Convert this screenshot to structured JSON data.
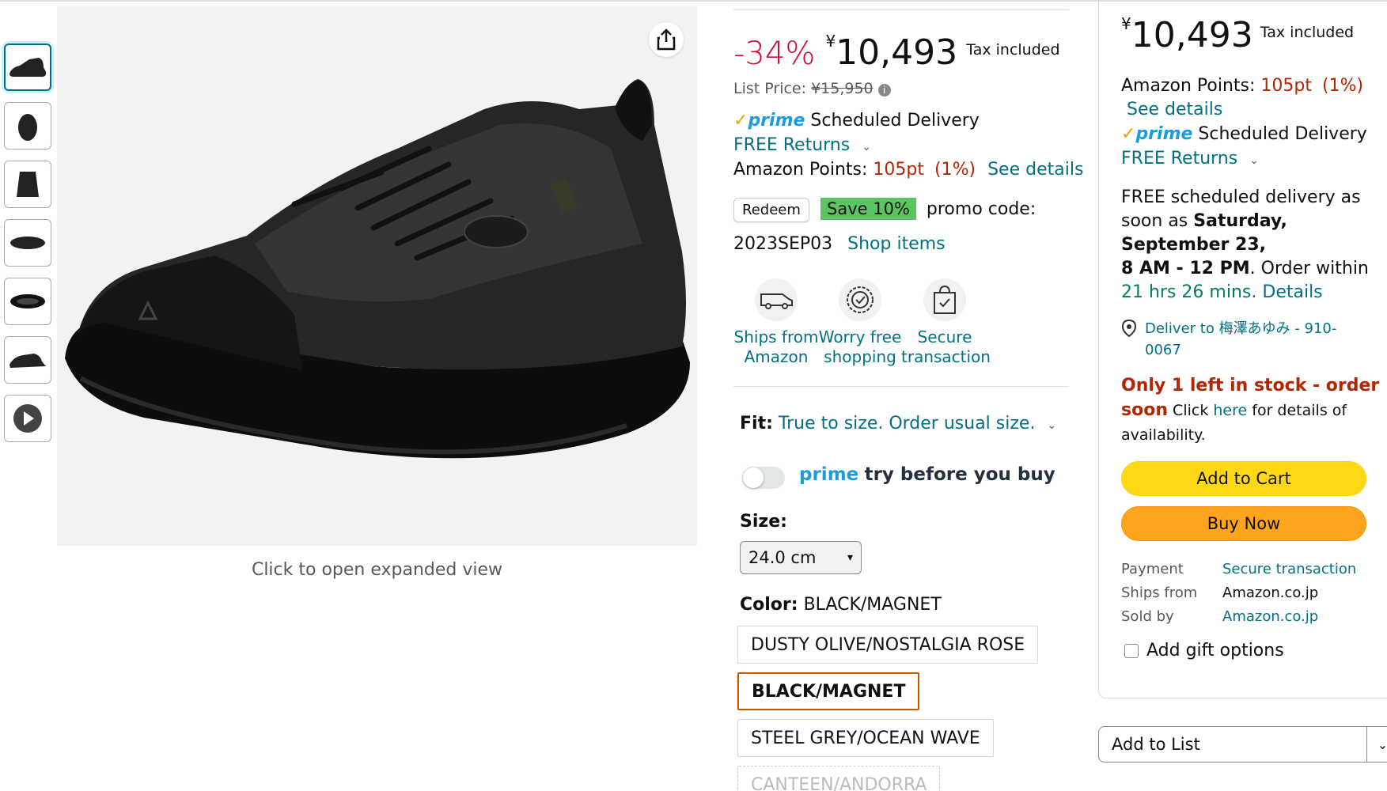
{
  "gallery": {
    "thumbnails": [
      "side-view",
      "top-view",
      "front-view",
      "sole-view",
      "bottom-view",
      "pair-view",
      "video"
    ],
    "caption": "Click to open expanded view"
  },
  "price": {
    "discount": "-34%",
    "currency": "¥",
    "amount": "10,493",
    "tax_note": "Tax included",
    "list_label": "List Price:",
    "list_price": "¥15,950"
  },
  "delivery": {
    "prime": "prime",
    "scheduled": "Scheduled Delivery",
    "free_returns": "FREE Returns",
    "points_label": "Amazon Points:",
    "points_value": "105pt",
    "points_pct": "(1%)",
    "see_details": "See details"
  },
  "promo": {
    "redeem": "Redeem",
    "save": "Save 10%",
    "promo_label": "promo code:",
    "code": "2023SEP03",
    "shop_items": "Shop items"
  },
  "trust": [
    {
      "icon": "van-icon",
      "line1": "Ships from",
      "line2": "Amazon"
    },
    {
      "icon": "shield-icon",
      "line1": "Worry free",
      "line2": "shopping"
    },
    {
      "icon": "bag-check-icon",
      "line1": "Secure",
      "line2": "transaction"
    }
  ],
  "fit": {
    "label": "Fit:",
    "value": "True to size. Order usual size."
  },
  "try_before": {
    "prime": "prime",
    "text": "try before you buy"
  },
  "size": {
    "label": "Size:",
    "selected": "24.0 cm"
  },
  "color": {
    "label": "Color:",
    "selected": "BLACK/MAGNET",
    "options": [
      "DUSTY OLIVE/NOSTALGIA ROSE",
      "BLACK/MAGNET",
      "STEEL GREY/OCEAN WAVE",
      "CANTEEN/ANDORRA"
    ]
  },
  "buybox": {
    "currency": "¥",
    "amount": "10,493",
    "tax_note": "Tax included",
    "points_label": "Amazon Points:",
    "points_value": "105pt",
    "points_pct": "(1%)",
    "see_details": "See details",
    "prime": "prime",
    "scheduled": "Scheduled Delivery",
    "free_returns": "FREE Returns",
    "delivery_line1": "FREE scheduled delivery as",
    "delivery_line2_pre": "soon as ",
    "delivery_date1": "Saturday,",
    "delivery_date2": "September 23,",
    "delivery_time": "8 AM - 12 PM",
    "order_within": ". Order within",
    "countdown": "21 hrs 26 mins",
    "details": "Details",
    "deliver_to_1": "Deliver to 梅澤あゆみ - 910-",
    "deliver_to_2": "0067",
    "stock_1": "Only 1 left in stock - order",
    "stock_2": "soon",
    "click": "Click",
    "here": "here",
    "for_details": "for details of",
    "availability": "availability.",
    "add_to_cart": "Add to Cart",
    "buy_now": "Buy Now",
    "payment_label": "Payment",
    "payment_value": "Secure transaction",
    "ships_label": "Ships from",
    "ships_value": "Amazon.co.jp",
    "sold_label": "Sold by",
    "sold_value": "Amazon.co.jp",
    "gift": "Add gift options",
    "add_to_list": "Add to List"
  }
}
